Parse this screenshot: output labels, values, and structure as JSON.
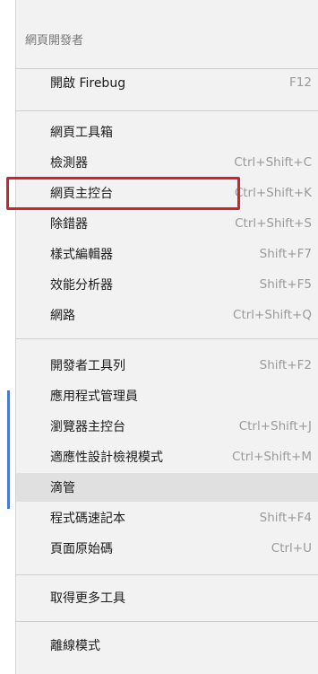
{
  "menu": {
    "header": "網頁開發者",
    "items": [
      {
        "label": "開啟 Firebug",
        "shortcut": "F12"
      },
      {
        "label": "網頁工具箱",
        "shortcut": ""
      },
      {
        "label": "檢測器",
        "shortcut": "Ctrl+Shift+C"
      },
      {
        "label": "網頁主控台",
        "shortcut": "Ctrl+Shift+K"
      },
      {
        "label": "除錯器",
        "shortcut": "Ctrl+Shift+S"
      },
      {
        "label": "樣式編輯器",
        "shortcut": "Shift+F7"
      },
      {
        "label": "效能分析器",
        "shortcut": "Shift+F5"
      },
      {
        "label": "網路",
        "shortcut": "Ctrl+Shift+Q"
      },
      {
        "label": "開發者工具列",
        "shortcut": "Shift+F2"
      },
      {
        "label": "應用程式管理員",
        "shortcut": ""
      },
      {
        "label": "瀏覽器主控台",
        "shortcut": "Ctrl+Shift+J"
      },
      {
        "label": "適應性設計檢視模式",
        "shortcut": "Ctrl+Shift+M"
      },
      {
        "label": "滴管",
        "shortcut": ""
      },
      {
        "label": "程式碼速記本",
        "shortcut": "Shift+F4"
      },
      {
        "label": "頁面原始碼",
        "shortcut": "Ctrl+U"
      },
      {
        "label": "取得更多工具",
        "shortcut": ""
      },
      {
        "label": "離線模式",
        "shortcut": ""
      }
    ]
  },
  "colors": {
    "menu_background": "#f2f2f2",
    "hover_background": "#e0e0e0",
    "highlight_border": "#d9202a",
    "shortcut_text": "#9a9a9a"
  }
}
